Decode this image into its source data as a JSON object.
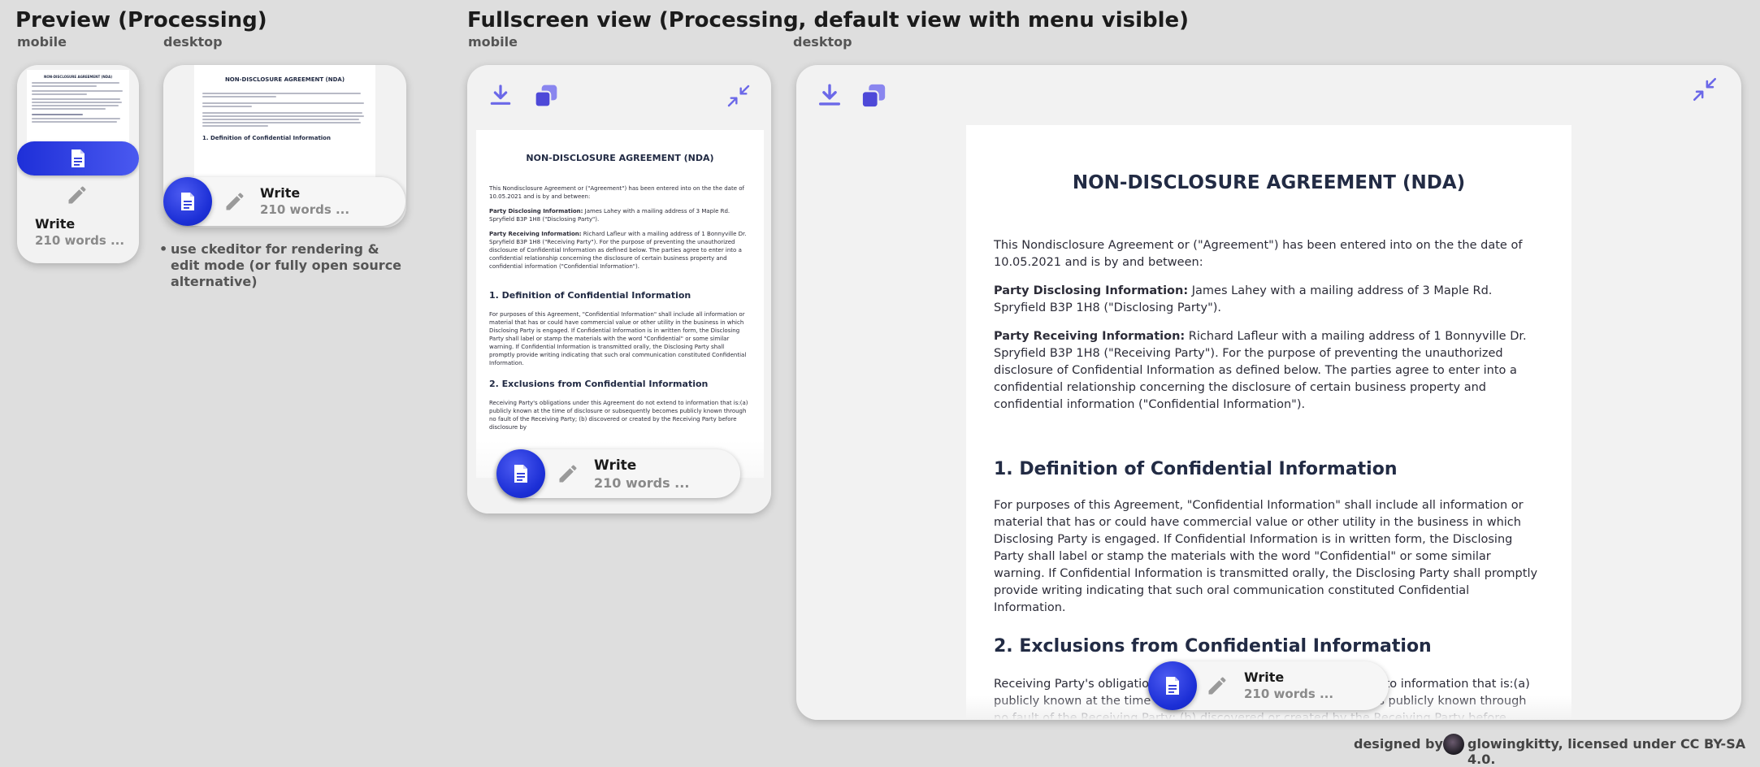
{
  "sections": {
    "preview_title": "Preview (Processing)",
    "fullscreen_title": "Fullscreen view (Processing, default view with menu visible)",
    "mobile_label": "mobile",
    "desktop_label": "desktop"
  },
  "document": {
    "title": "NON-DISCLOSURE AGREEMENT (NDA)",
    "intro": "This Nondisclosure Agreement or (\"Agreement\") has been entered into on the the date of 10.05.2021 and is by and between:",
    "party_disclosing_label": "Party Disclosing Information:",
    "party_disclosing_text": " James Lahey with a mailing address of 3 Maple Rd. Spryfield B3P 1H8  (\"Disclosing Party\").",
    "party_receiving_label": "Party Receiving Information:",
    "party_receiving_text": "  Richard Lafleur with a mailing address of  1 Bonnyville Dr. Spryfield B3P 1H8 (\"Receiving Party\"). For the purpose of preventing the unauthorized disclosure of Confidential Information as defined below. The parties agree to enter into a confidential relationship concerning the disclosure of certain business property and confidential information (\"Confidential Information\").",
    "section1_heading": "1. Definition of Confidential Information",
    "section1_text": "For purposes of this Agreement, \"Confidential Information\" shall include all information or material that has or could have commercial value or other utility in the business in which Disclosing Party is engaged. If Confidential Information is in written form, the Disclosing Party shall label or stamp the materials with the word \"Confidential\" or some similar warning. If Confidential Information is transmitted orally, the Disclosing Party shall promptly provide writing indicating that such oral communication constituted Confidential Information.",
    "section2_heading": "2. Exclusions from Confidential Information",
    "section2_text": "Receiving Party's obligations under this Agreement do not extend to information that is:(a) publicly known at the time of disclosure or subsequently becomes publicly known through no fault of the Receiving Party; (b) discovered or created by the Receiving Party before disclosure by"
  },
  "pill": {
    "title": "Write",
    "subtitle": "210 words ..."
  },
  "note": "use ckeditor for rendering & edit mode (or fully open source alternative)",
  "footer": {
    "designed_by": "designed by",
    "license": "glowingkitty, licensed under CC BY-SA 4.0."
  },
  "colors": {
    "accent": "#2432d9",
    "icon": "#6b68e8",
    "card_bg": "#f2f2f2",
    "page_bg": "#dedede"
  },
  "icons": [
    "document-icon",
    "pencil-icon",
    "download-icon",
    "copy-icon",
    "minimize-icon"
  ]
}
